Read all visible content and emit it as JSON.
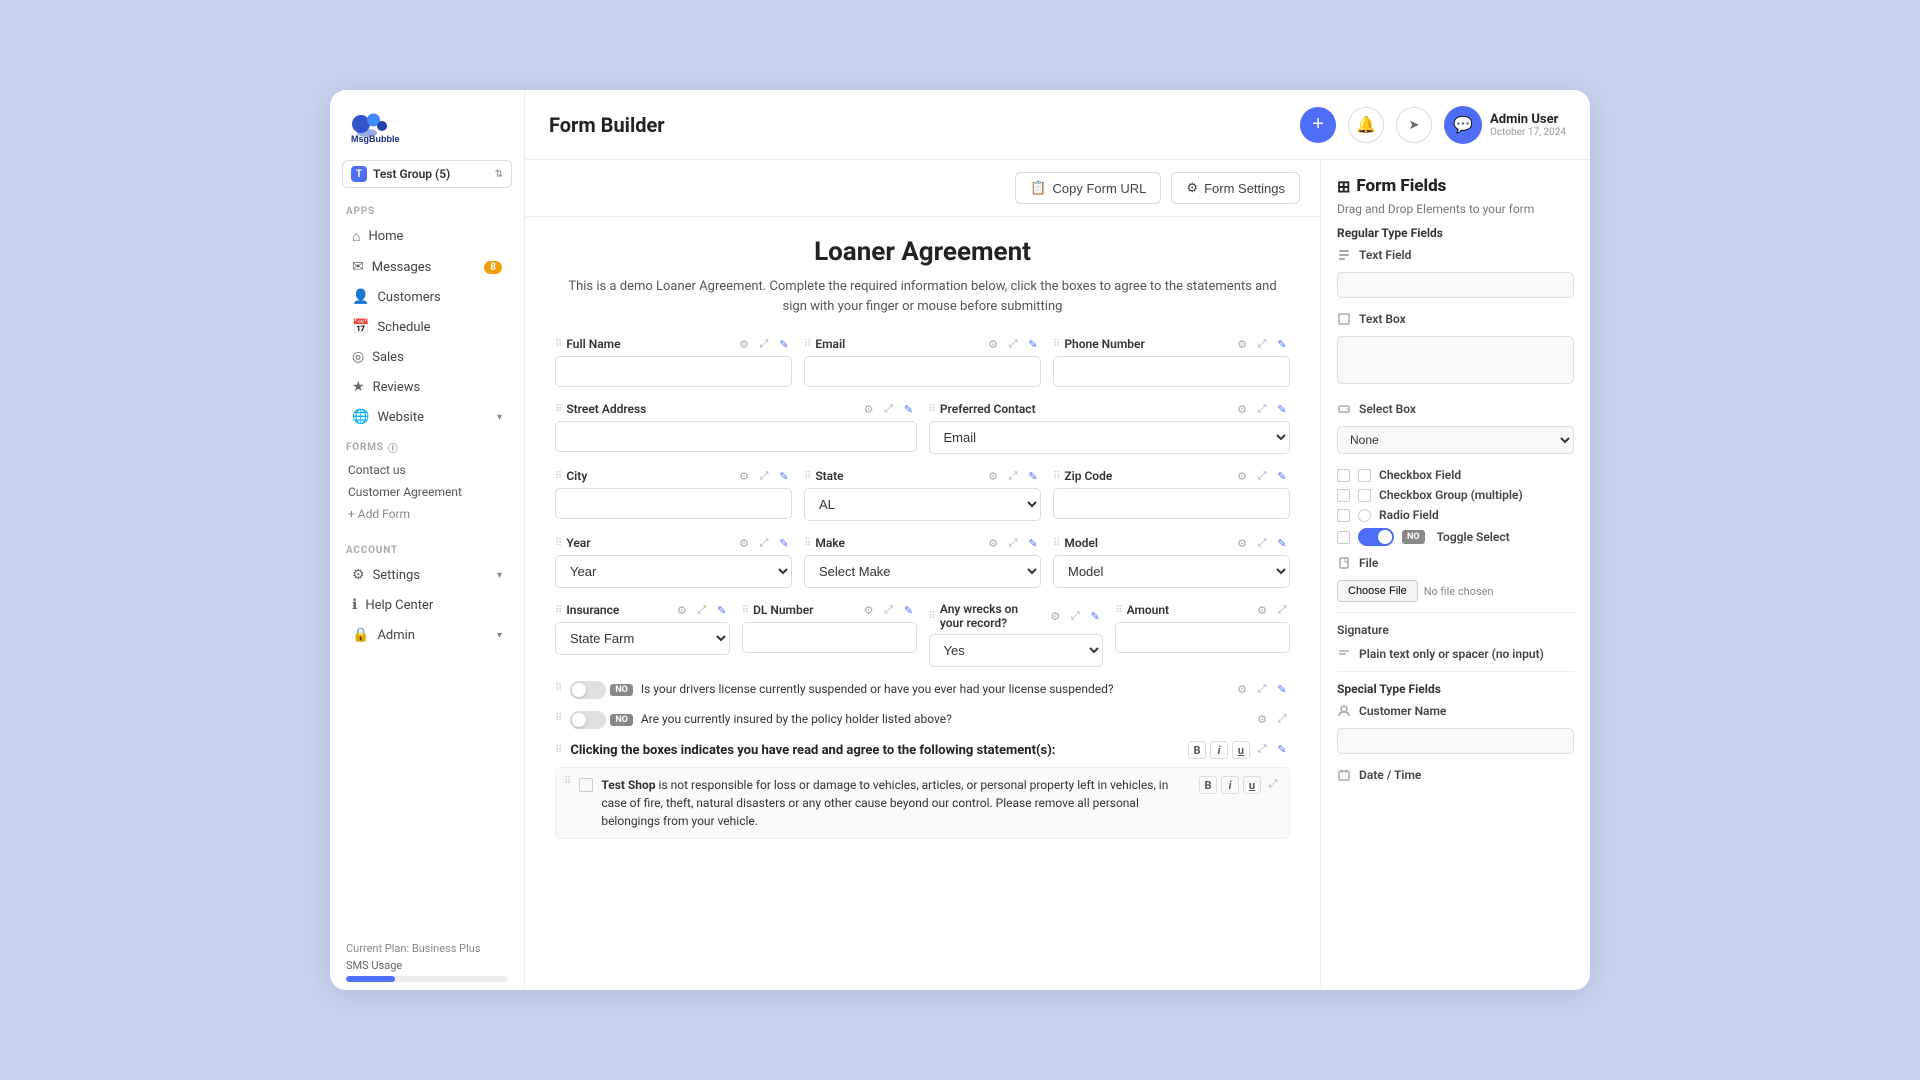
{
  "app": {
    "name": "MsgBubble",
    "page_title": "Form Builder"
  },
  "group": {
    "badge": "T",
    "name": "Test Group (5)"
  },
  "sidebar": {
    "apps_label": "APPS",
    "items": [
      {
        "id": "home",
        "label": "Home",
        "icon": "⌂"
      },
      {
        "id": "messages",
        "label": "Messages",
        "icon": "✉",
        "badge": "8"
      },
      {
        "id": "customers",
        "label": "Customers",
        "icon": "👤"
      },
      {
        "id": "schedule",
        "label": "Schedule",
        "icon": "📅"
      },
      {
        "id": "sales",
        "label": "Sales",
        "icon": "◎"
      },
      {
        "id": "reviews",
        "label": "Reviews",
        "icon": "★"
      },
      {
        "id": "website",
        "label": "Website",
        "icon": "🌐",
        "arrow": "▾"
      }
    ],
    "forms_label": "FORMS",
    "form_items": [
      "Contact us",
      "Customer Agreement"
    ],
    "add_form_label": "+ Add Form",
    "account_label": "ACCOUNT",
    "account_items": [
      {
        "id": "settings",
        "label": "Settings",
        "icon": "⚙",
        "arrow": "▾"
      },
      {
        "id": "help",
        "label": "Help Center",
        "icon": "ℹ"
      },
      {
        "id": "admin",
        "label": "Admin",
        "icon": "🔒",
        "arrow": "▾"
      }
    ],
    "plan_label": "Current Plan: Business Plus",
    "sms_label": "SMS Usage"
  },
  "topbar": {
    "add_btn": "+",
    "notif_icon": "🔔",
    "send_icon": "➤",
    "admin_name": "Admin User",
    "admin_date": "October 17, 2024",
    "copy_url_btn": "Copy Form URL",
    "form_settings_btn": "Form Settings"
  },
  "form": {
    "title": "Loaner Agreement",
    "description": "This is a demo Loaner Agreement. Complete the required information below, click the boxes to agree to the statements and sign with your\nfinger or mouse before submitting",
    "fields": {
      "full_name": "Full Name",
      "email": "Email",
      "phone_number": "Phone Number",
      "street_address": "Street Address",
      "preferred_contact": "Preferred Contact",
      "preferred_contact_default": "Email",
      "city": "City",
      "state": "State",
      "state_default": "AL",
      "zip_code": "Zip Code",
      "year": "Year",
      "year_default": "Year",
      "make": "Make",
      "make_default": "Select Make",
      "model": "Model",
      "model_default": "Model",
      "insurance": "Insurance",
      "insurance_default": "State Farm",
      "dl_number": "DL Number",
      "wrecks": "Any wrecks on your record?",
      "wrecks_default": "Yes",
      "amount": "Amount"
    },
    "toggle_q1": "Is your drivers license currently suspended or have you ever had your license suspended?",
    "toggle_q2": "Are you currently insured by the policy holder listed above?",
    "statement_header": "Clicking the boxes indicates you have read and agree to the following statement(s):",
    "statement_shop": "Test Shop",
    "statement_text": " is not responsible for loss or damage to vehicles, articles, or personal property left in vehicles, in case of fire, theft, natural disasters or any other cause beyond our control. Please remove all personal belongings from your vehicle."
  },
  "panel": {
    "title": "Form Fields",
    "subtitle": "Drag and Drop Elements to your form",
    "regular_label": "Regular Type Fields",
    "text_field_label": "Text Field",
    "text_box_label": "Text Box",
    "select_box_label": "Select Box",
    "select_box_default": "None",
    "checkbox_label": "Checkbox Field",
    "checkbox_group_label": "Checkbox Group (multiple)",
    "radio_label": "Radio Field",
    "toggle_label": "Toggle Select",
    "file_label": "File",
    "choose_file_btn": "Choose File",
    "no_file_text": "No file chosen",
    "signature_label": "Signature",
    "plain_text_label": "Plain text only or spacer (no input)",
    "special_label": "Special Type Fields",
    "customer_name_label": "Customer Name",
    "date_time_label": "Date / Time"
  }
}
